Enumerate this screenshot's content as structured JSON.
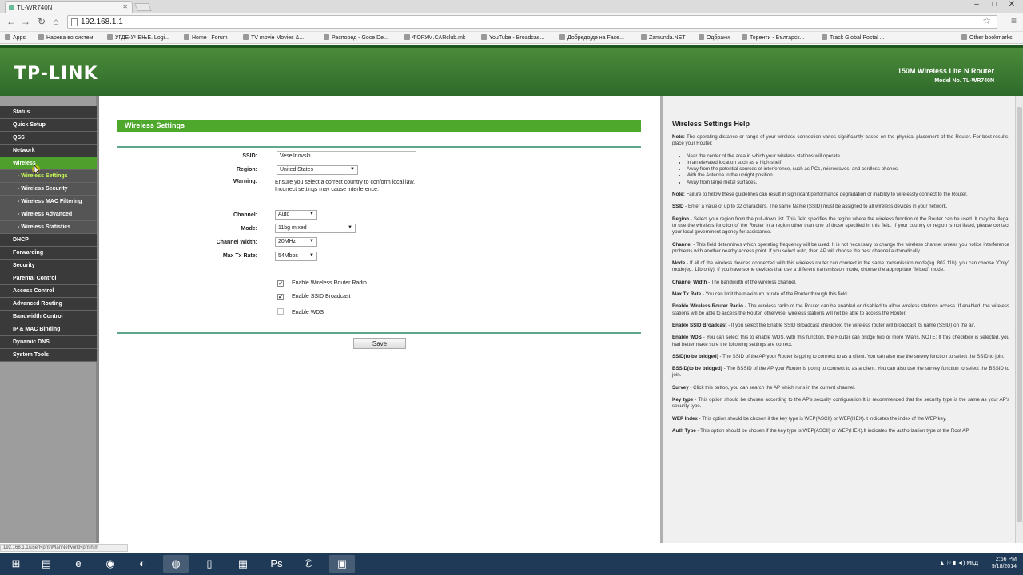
{
  "browser": {
    "tab_title": "TL-WR740N",
    "url": "192.168.1.1",
    "bookmarks": [
      "Apps",
      "Нарева во систем",
      "УГДЕ-УЧЕЊЕ. Logi...",
      "Home | Forum",
      "TV movie Movies &...",
      "Распоред - Goce De...",
      "ФОРУМ.CARclub.mk",
      "YouTube - Broadcas...",
      "Добредојде на Face...",
      "Zamunda.NET",
      "Одбрани",
      "Торенти - Българск...",
      "Track Global Postal ..."
    ],
    "other_bookmarks": "Other bookmarks",
    "status_url": "192.168.1.1/userRpm/WlanNetworkRpm.htm"
  },
  "header": {
    "logo": "TP-LINK",
    "product": "150M Wireless Lite N Router",
    "model": "Model No. TL-WR740N"
  },
  "sidebar": {
    "items": [
      {
        "label": "Status",
        "type": "main"
      },
      {
        "label": "Quick Setup",
        "type": "main"
      },
      {
        "label": "QSS",
        "type": "main"
      },
      {
        "label": "Network",
        "type": "main"
      },
      {
        "label": "Wireless",
        "type": "active"
      },
      {
        "label": "- Wireless Settings",
        "type": "current"
      },
      {
        "label": "- Wireless Security",
        "type": "sub"
      },
      {
        "label": "- Wireless MAC Filtering",
        "type": "sub"
      },
      {
        "label": "- Wireless Advanced",
        "type": "sub"
      },
      {
        "label": "- Wireless Statistics",
        "type": "sub"
      },
      {
        "label": "DHCP",
        "type": "main"
      },
      {
        "label": "Forwarding",
        "type": "main"
      },
      {
        "label": "Security",
        "type": "main"
      },
      {
        "label": "Parental Control",
        "type": "main"
      },
      {
        "label": "Access Control",
        "type": "main"
      },
      {
        "label": "Advanced Routing",
        "type": "main"
      },
      {
        "label": "Bandwidth Control",
        "type": "main"
      },
      {
        "label": "IP & MAC Binding",
        "type": "main"
      },
      {
        "label": "Dynamic DNS",
        "type": "main"
      },
      {
        "label": "System Tools",
        "type": "main"
      }
    ]
  },
  "form": {
    "title": "Wireless Settings",
    "ssid_label": "SSID:",
    "ssid_value": "Vesellnovski",
    "region_label": "Region:",
    "region_value": "United States",
    "warning_label": "Warning:",
    "warning_line1": "Ensure you select a correct country to conform local law.",
    "warning_line2": "Incorrect settings may cause interference.",
    "channel_label": "Channel:",
    "channel_value": "Auto",
    "mode_label": "Mode:",
    "mode_value": "11bg mixed",
    "width_label": "Channel Width:",
    "width_value": "20MHz",
    "rate_label": "Max Tx Rate:",
    "rate_value": "54Mbps",
    "radio_label": "Enable Wireless Router Radio",
    "radio_checked": true,
    "broadcast_label": "Enable SSID Broadcast",
    "broadcast_checked": true,
    "wds_label": "Enable WDS",
    "wds_checked": false,
    "save_label": "Save"
  },
  "help": {
    "title": "Wireless Settings Help",
    "note1_label": "Note:",
    "note1": " The operating distance or range of your wireless connection varies significantly based on the physical placement of the Router. For best results, place your Router:",
    "bullets": [
      "Near the center of the area in which your wireless stations will operate.",
      "In an elevated location such as a high shelf.",
      "Away from the potential sources of interference, such as PCs, microwaves, and cordless phones.",
      "With the Antenna in the upright position.",
      "Away from large metal surfaces."
    ],
    "note2_label": "Note:",
    "note2": " Failure to follow these guidelines can result in significant performance degradation or inability to wirelessly connect to the Router.",
    "entries": [
      {
        "term": "SSID",
        "text": " - Enter a value of up to 32 characters. The same Name (SSID) must be assigned to all wireless devices in your network."
      },
      {
        "term": "Region",
        "text": " - Select your region from the pull-down list. This field specifies the region where the wireless function of the Router can be used. It may be illegal to use the wireless function of the Router in a region other than one of those specified in this field. If your country or region is not listed, please contact your local government agency for assistance."
      },
      {
        "term": "Channel",
        "text": " - This field determines which operating frequency will be used. It is not necessary to change the wireless channel unless you notice interference problems with another nearby access point. If you select auto, then AP will choose the best channel automatically."
      },
      {
        "term": "Mode",
        "text": " - If all of the wireless devices connected with this wireless router can connect in the same transmission mode(eg. 802.11b), you can choose \"Only\" mode(eg. 11b only). If you have some devices that use a different transmission mode, choose the appropriate \"Mixed\" mode."
      },
      {
        "term": "Channel Width",
        "text": " - The bandwidth of the wireless channel."
      },
      {
        "term": "Max Tx Rate",
        "text": " - You can limit the maximum tx rate of the Router through this field."
      },
      {
        "term": "Enable Wireless Router Radio",
        "text": " - The wireless radio of the Router can be enabled or disabled to allow wireless stations access. If enabled, the wireless stations will be able to access the Router, otherwise, wireless stations will not be able to access the Router."
      },
      {
        "term": "Enable SSID Broadcast",
        "text": " - If you select the Enable SSID Broadcast checkbox, the wireless router will broadcast its name (SSID) on the air."
      },
      {
        "term": "Enable WDS",
        "text": " - You can select this to enable WDS, with this function, the Router can bridge two or more Wlans. NOTE: If this checkbox is selected, you had better make sure the following settings are correct."
      },
      {
        "term": "SSID(to be bridged)",
        "text": " - The SSID of the AP your Router is going to connect to as a client. You can also use the survey function to select the SSID to join."
      },
      {
        "term": "BSSID(to be bridged)",
        "text": " - The BSSID of the AP your Router is going to connect to as a client. You can also use the survey function to select the BSSID to join."
      },
      {
        "term": "Survey",
        "text": " - Click this button, you can search the AP which runs in the current channel."
      },
      {
        "term": "Key type",
        "text": " - This option should be chosen according to the AP's security configuration.It is recommended that the security type is the same as your AP's security type."
      },
      {
        "term": "WEP Index",
        "text": " - This option should be chosen if the key type is WEP(ASCII) or WEP(HEX).It indicates the index of the WEP key."
      },
      {
        "term": "Auth Type",
        "text": " - This option should be chosen if the key type is WEP(ASCII) or WEP(HEX).It indicates the authorization type of the Root AP."
      }
    ]
  },
  "taskbar": {
    "language": "МКД",
    "time": "2:56 PM",
    "date": "9/18/2014"
  }
}
